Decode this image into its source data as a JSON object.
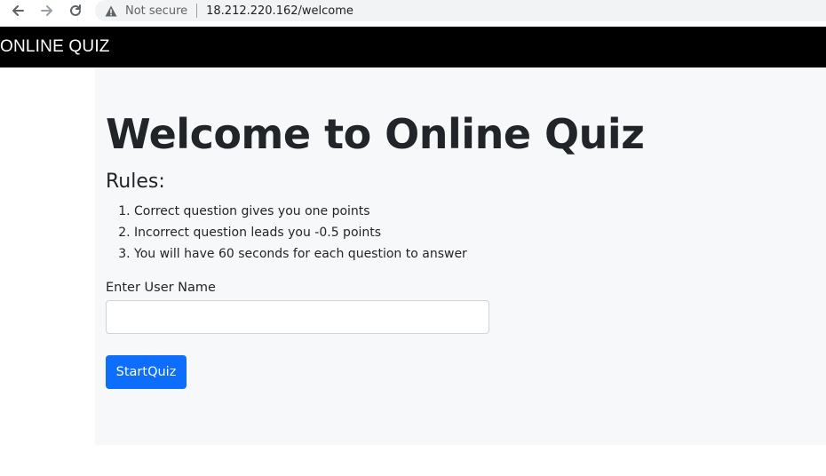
{
  "browser": {
    "security_label": "Not secure",
    "url": "18.212.220.162/welcome",
    "icons": {
      "back": "arrow-left-icon",
      "forward": "arrow-right-icon",
      "reload": "reload-icon",
      "warning": "warning-triangle-icon"
    }
  },
  "navbar": {
    "brand": "ONLINE QUIZ",
    "background": "#000000"
  },
  "main": {
    "title": "Welcome to Online Quiz",
    "rules_heading": "Rules:",
    "rules": [
      "Correct question gives you one points",
      "Incorrect question leads you -0.5 points",
      "You will have 60 seconds for each question to answer"
    ],
    "username_label": "Enter User Name",
    "username_value": "",
    "start_button": "StartQuiz",
    "accent": "#0d6efd"
  }
}
